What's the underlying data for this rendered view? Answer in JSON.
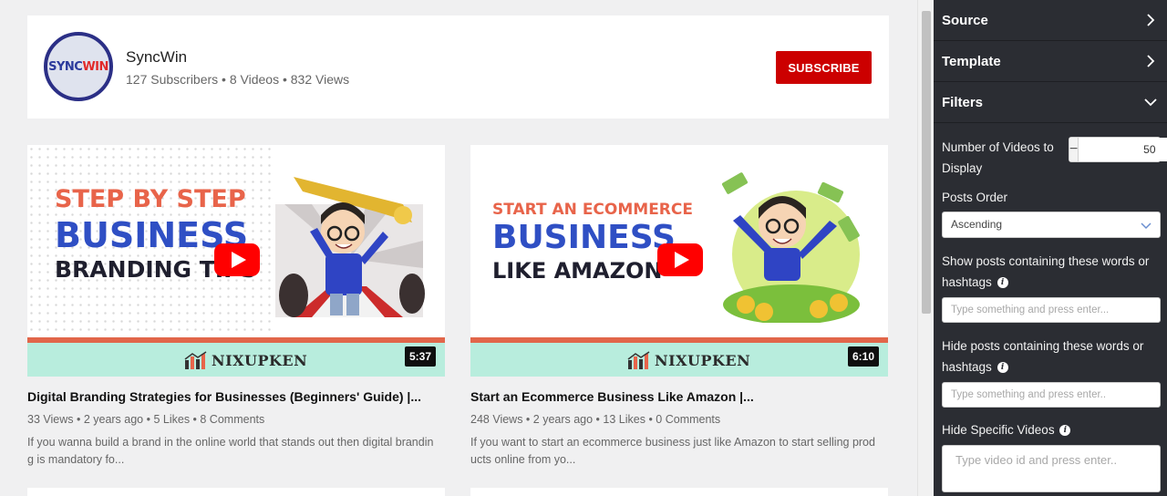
{
  "channel": {
    "logo_text_blue": "SYNC",
    "logo_text_red": "WIN",
    "name": "SyncWin",
    "stats": "127 Subscribers • 8 Videos • 832 Views",
    "subscribe_label": "SUBSCRIBE"
  },
  "videos": [
    {
      "thumb_line1": "STEP BY STEP",
      "thumb_line2": "BUSINESS",
      "thumb_line3": "BRANDING TIPS",
      "brand": "NIXUPKEN",
      "duration": "5:37",
      "title": "Digital Branding Strategies for Businesses (Beginners' Guide) |...",
      "meta": "33 Views • 2 years ago • 5 Likes • 8 Comments",
      "description": "If you wanna build a brand in the online world that stands out then digital branding is mandatory fo..."
    },
    {
      "thumb_line1": "START AN ECOMMERCE",
      "thumb_line2": "BUSINESS",
      "thumb_line3": "LIKE AMAZON",
      "brand": "NIXUPKEN",
      "duration": "6:10",
      "title": "Start an Ecommerce Business Like Amazon |...",
      "meta": "248 Views • 2 years ago • 13 Likes • 0 Comments",
      "description": "If you want to start an ecommerce business just like Amazon to start selling products online from yo..."
    }
  ],
  "sidebar": {
    "sections": [
      "Source",
      "Template",
      "Filters"
    ],
    "number_label": "Number of Videos to Display",
    "number_value": "50",
    "minus": "−",
    "plus": "+",
    "order_label": "Posts Order",
    "order_value": "Ascending",
    "show_label": "Show posts containing these words or hashtags",
    "show_placeholder": "Type something and press enter...",
    "hide_label": "Hide posts containing these words or hashtags",
    "hide_placeholder": "Type something and press enter..",
    "hide_videos_label": "Hide Specific Videos",
    "hide_videos_placeholder": "Type video id and press enter..",
    "info_glyph": "i"
  },
  "colors": {
    "subscribe": "#cc0000",
    "sidebar_bg": "#2b2d33",
    "thumb_blue": "#2f4fc4",
    "thumb_orange": "#e8644a",
    "thumb_band": "#b8eddd"
  }
}
